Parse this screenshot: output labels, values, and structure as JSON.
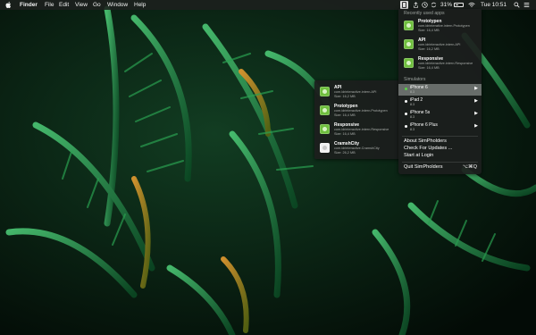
{
  "menubar": {
    "apple_icon": "apple-icon",
    "items": [
      "Finder",
      "File",
      "Edit",
      "View",
      "Go",
      "Window",
      "Help"
    ],
    "tray": {
      "icons": [
        "simpholders-icon",
        "share-icon",
        "time-machine-icon",
        "battery-icon",
        "wifi-icon",
        "search-icon",
        "list-icon"
      ],
      "battery_percent": "31%",
      "clock": "Tue 10:51"
    }
  },
  "main_menu": {
    "recent_header": "Recently used apps",
    "recent_apps": [
      {
        "name": "Prototypen",
        "bundle": "com.idrinterative.intern.Prototypen",
        "size": "Size: 16,4 MB"
      },
      {
        "name": "API",
        "bundle": "com.idrinteractive.intern.API",
        "size": "Size: 16,2 MB"
      },
      {
        "name": "Responsive",
        "bundle": "com.idrinteractive.intern.Responsive",
        "size": "Size: 16,4 MB"
      }
    ],
    "simulators_header": "Simulators",
    "simulators": [
      {
        "name": "iPhone 6",
        "version": "8.3",
        "active": true
      },
      {
        "name": "iPad 2",
        "version": "8.3",
        "active": false
      },
      {
        "name": "iPhone 5s",
        "version": "8.3",
        "active": false
      },
      {
        "name": "iPhone 6 Plus",
        "version": "8.3",
        "active": false
      }
    ],
    "about": "About SimPholders",
    "check_updates": "Check For Updates ...",
    "start_login": "Start at Login",
    "quit": "Quit SimPholders",
    "quit_shortcut": "⌥⌘Q"
  },
  "apps_submenu": {
    "apps": [
      {
        "name": "API",
        "bundle": "com.idrinteractive.intern.API",
        "size": "Size: 16,2 MB",
        "icon": "green"
      },
      {
        "name": "Prototypen",
        "bundle": "com.idrinteractive.intern.Prototypen",
        "size": "Size: 16,4 MB",
        "icon": "green"
      },
      {
        "name": "Responsive",
        "bundle": "com.idrinteractive.intern.Responsive",
        "size": "Size: 16,4 MB",
        "icon": "green"
      },
      {
        "name": "CramshCity",
        "bundle": "com.idrinteractive.CramshCity",
        "size": "Size: 26,2 MB",
        "icon": "white"
      }
    ]
  },
  "colors": {
    "app_icon_green": "#6fbe3e",
    "active_dot": "#5ad04a",
    "menubar_bg": "#1c201e"
  }
}
